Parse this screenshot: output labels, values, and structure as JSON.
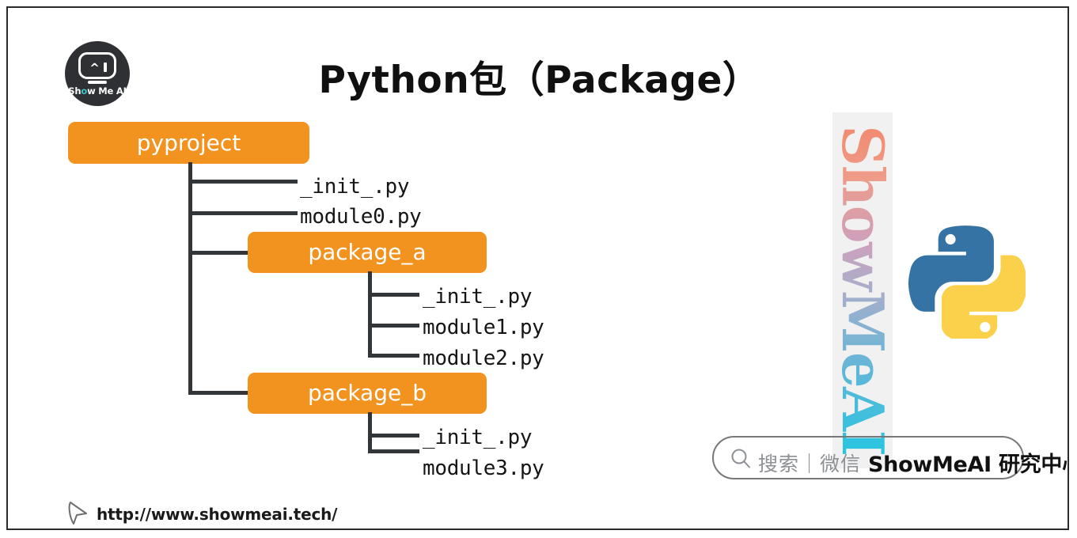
{
  "slide": {
    "title": "Python包（Package）",
    "background_color": "#ffffff",
    "border_color": "#2b2b2b",
    "accent_color": "#F2931F"
  },
  "logo": {
    "name": "show-me-ai-logo",
    "text_show": "Sh",
    "text_o": "o",
    "text_rest": "w Me AI",
    "eye_left": "^",
    "circle_color": "#2e3033",
    "accent_color": "#39c3c8"
  },
  "tree": {
    "root": {
      "label": "pyproject",
      "children": [
        {
          "label": "_init_.py",
          "type": "file"
        },
        {
          "label": "module0.py",
          "type": "file"
        },
        {
          "label": "package_a",
          "type": "package",
          "children": [
            {
              "label": "_init_.py",
              "type": "file"
            },
            {
              "label": "module1.py",
              "type": "file"
            },
            {
              "label": "module2.py",
              "type": "file"
            }
          ]
        },
        {
          "label": "package_b",
          "type": "package",
          "children": [
            {
              "label": "_init_.py",
              "type": "file"
            },
            {
              "label": "module3.py",
              "type": "file"
            }
          ]
        }
      ]
    }
  },
  "watermark": {
    "text": "ShowMeAI",
    "strip_color": "#f1f1f1"
  },
  "python_logo": {
    "name": "python-logo",
    "blue": "#3573A5",
    "yellow": "#FBD04A"
  },
  "search": {
    "placeholder": "搜索｜微信",
    "brand": "ShowMeAI 研究中心",
    "icon": "search-icon",
    "border_color": "#76797c"
  },
  "footer": {
    "url": "http://www.showmeai.tech/",
    "cursor_icon": "cursor-arrow-icon"
  }
}
